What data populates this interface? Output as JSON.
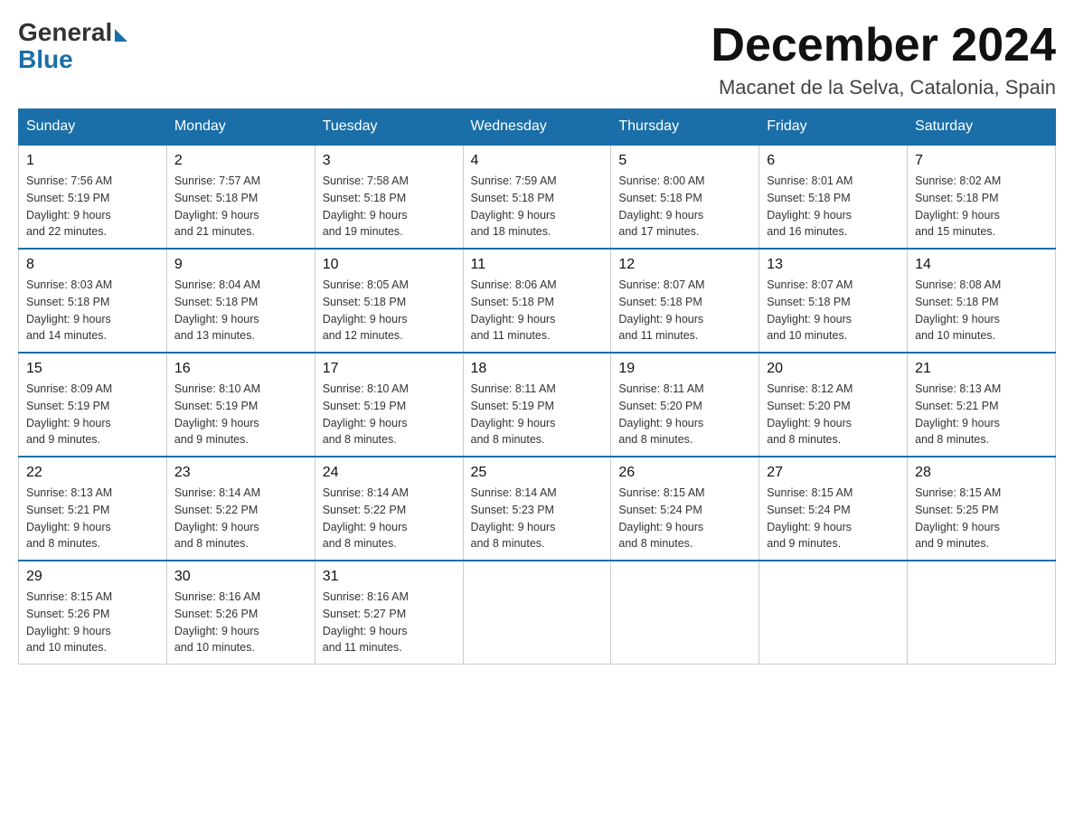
{
  "logo": {
    "general": "General",
    "blue": "Blue"
  },
  "title": "December 2024",
  "location": "Macanet de la Selva, Catalonia, Spain",
  "days_of_week": [
    "Sunday",
    "Monday",
    "Tuesday",
    "Wednesday",
    "Thursday",
    "Friday",
    "Saturday"
  ],
  "weeks": [
    [
      {
        "day": "1",
        "sunrise": "7:56 AM",
        "sunset": "5:19 PM",
        "daylight": "9 hours and 22 minutes."
      },
      {
        "day": "2",
        "sunrise": "7:57 AM",
        "sunset": "5:18 PM",
        "daylight": "9 hours and 21 minutes."
      },
      {
        "day": "3",
        "sunrise": "7:58 AM",
        "sunset": "5:18 PM",
        "daylight": "9 hours and 19 minutes."
      },
      {
        "day": "4",
        "sunrise": "7:59 AM",
        "sunset": "5:18 PM",
        "daylight": "9 hours and 18 minutes."
      },
      {
        "day": "5",
        "sunrise": "8:00 AM",
        "sunset": "5:18 PM",
        "daylight": "9 hours and 17 minutes."
      },
      {
        "day": "6",
        "sunrise": "8:01 AM",
        "sunset": "5:18 PM",
        "daylight": "9 hours and 16 minutes."
      },
      {
        "day": "7",
        "sunrise": "8:02 AM",
        "sunset": "5:18 PM",
        "daylight": "9 hours and 15 minutes."
      }
    ],
    [
      {
        "day": "8",
        "sunrise": "8:03 AM",
        "sunset": "5:18 PM",
        "daylight": "9 hours and 14 minutes."
      },
      {
        "day": "9",
        "sunrise": "8:04 AM",
        "sunset": "5:18 PM",
        "daylight": "9 hours and 13 minutes."
      },
      {
        "day": "10",
        "sunrise": "8:05 AM",
        "sunset": "5:18 PM",
        "daylight": "9 hours and 12 minutes."
      },
      {
        "day": "11",
        "sunrise": "8:06 AM",
        "sunset": "5:18 PM",
        "daylight": "9 hours and 11 minutes."
      },
      {
        "day": "12",
        "sunrise": "8:07 AM",
        "sunset": "5:18 PM",
        "daylight": "9 hours and 11 minutes."
      },
      {
        "day": "13",
        "sunrise": "8:07 AM",
        "sunset": "5:18 PM",
        "daylight": "9 hours and 10 minutes."
      },
      {
        "day": "14",
        "sunrise": "8:08 AM",
        "sunset": "5:18 PM",
        "daylight": "9 hours and 10 minutes."
      }
    ],
    [
      {
        "day": "15",
        "sunrise": "8:09 AM",
        "sunset": "5:19 PM",
        "daylight": "9 hours and 9 minutes."
      },
      {
        "day": "16",
        "sunrise": "8:10 AM",
        "sunset": "5:19 PM",
        "daylight": "9 hours and 9 minutes."
      },
      {
        "day": "17",
        "sunrise": "8:10 AM",
        "sunset": "5:19 PM",
        "daylight": "9 hours and 8 minutes."
      },
      {
        "day": "18",
        "sunrise": "8:11 AM",
        "sunset": "5:19 PM",
        "daylight": "9 hours and 8 minutes."
      },
      {
        "day": "19",
        "sunrise": "8:11 AM",
        "sunset": "5:20 PM",
        "daylight": "9 hours and 8 minutes."
      },
      {
        "day": "20",
        "sunrise": "8:12 AM",
        "sunset": "5:20 PM",
        "daylight": "9 hours and 8 minutes."
      },
      {
        "day": "21",
        "sunrise": "8:13 AM",
        "sunset": "5:21 PM",
        "daylight": "9 hours and 8 minutes."
      }
    ],
    [
      {
        "day": "22",
        "sunrise": "8:13 AM",
        "sunset": "5:21 PM",
        "daylight": "9 hours and 8 minutes."
      },
      {
        "day": "23",
        "sunrise": "8:14 AM",
        "sunset": "5:22 PM",
        "daylight": "9 hours and 8 minutes."
      },
      {
        "day": "24",
        "sunrise": "8:14 AM",
        "sunset": "5:22 PM",
        "daylight": "9 hours and 8 minutes."
      },
      {
        "day": "25",
        "sunrise": "8:14 AM",
        "sunset": "5:23 PM",
        "daylight": "9 hours and 8 minutes."
      },
      {
        "day": "26",
        "sunrise": "8:15 AM",
        "sunset": "5:24 PM",
        "daylight": "9 hours and 8 minutes."
      },
      {
        "day": "27",
        "sunrise": "8:15 AM",
        "sunset": "5:24 PM",
        "daylight": "9 hours and 9 minutes."
      },
      {
        "day": "28",
        "sunrise": "8:15 AM",
        "sunset": "5:25 PM",
        "daylight": "9 hours and 9 minutes."
      }
    ],
    [
      {
        "day": "29",
        "sunrise": "8:15 AM",
        "sunset": "5:26 PM",
        "daylight": "9 hours and 10 minutes."
      },
      {
        "day": "30",
        "sunrise": "8:16 AM",
        "sunset": "5:26 PM",
        "daylight": "9 hours and 10 minutes."
      },
      {
        "day": "31",
        "sunrise": "8:16 AM",
        "sunset": "5:27 PM",
        "daylight": "9 hours and 11 minutes."
      },
      null,
      null,
      null,
      null
    ]
  ],
  "labels": {
    "sunrise": "Sunrise:",
    "sunset": "Sunset:",
    "daylight": "Daylight:"
  }
}
